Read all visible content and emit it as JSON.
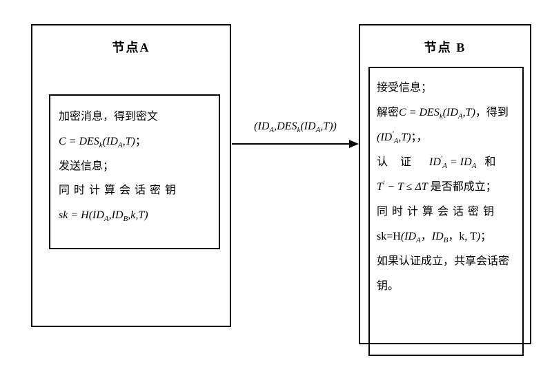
{
  "nodeA": {
    "title": "节点A",
    "lines": {
      "l1_prefix": "加密消息，得到密文",
      "l2_formula_C": "C",
      "l2_eq": " = ",
      "l2_des": "DES",
      "l2_k": "k",
      "l2_open": "(",
      "l2_ida": "ID",
      "l2_a": "A",
      "l2_comma": ",",
      "l2_t": "T",
      "l2_close": ")",
      "l2_semi": "；",
      "l3": "发送信息；",
      "l4": "同时计算会话密钥",
      "l5_sk": "sk",
      "l5_eq": " = ",
      "l5_h": "H",
      "l5_open": "(",
      "l5_ida": "ID",
      "l5_a": "A",
      "l5_c1": ",",
      "l5_idb": "ID",
      "l5_b": "B",
      "l5_c2": ",",
      "l5_k": "k",
      "l5_c3": ",",
      "l5_t": "T",
      "l5_close": ")"
    }
  },
  "arrow": {
    "label_open": "(",
    "label_ida": "ID",
    "label_a": "A",
    "label_c": ",",
    "label_des": "DES",
    "label_k": "k",
    "label_open2": "(",
    "label_ida2": "ID",
    "label_a2": "A",
    "label_c2": ",",
    "label_t": "T",
    "label_close2": ")",
    "label_close": ")"
  },
  "nodeB": {
    "title": "节点 B",
    "lines": {
      "l1": "接受信息；",
      "l2_prefix": "解密",
      "l2_c": "C",
      "l2_eq": " = ",
      "l2_des": "DES",
      "l2_k": "k",
      "l2_open": "(",
      "l2_ida": "ID",
      "l2_a": "A",
      "l2_comma": ",",
      "l2_t": "T",
      "l2_close": ")",
      "l2_suffix": "，得到",
      "l3_open": "(",
      "l3_id": "ID",
      "l3_prime": "'",
      "l3_a": "A",
      "l3_comma": ",",
      "l3_t": "T",
      "l3_close": ")",
      "l3_semi": "；，",
      "l4_prefix": "认证",
      "l4_id1": "ID",
      "l4_prime": "'",
      "l4_a1": "A",
      "l4_eq": " = ",
      "l4_id2": "ID",
      "l4_a2": "A",
      "l4_suffix": "和",
      "l5_t": "T",
      "l5_prime": "'",
      "l5_minus": " − ",
      "l5_t2": "T",
      "l5_le": " ≤ ",
      "l5_delta": "Δ",
      "l5_t3": "T",
      "l5_suffix": " 是否都成立；",
      "l6": "同时计算会话密钥",
      "l7_sk": "sk=H",
      "l7_open": "(",
      "l7_ida": "ID",
      "l7_a": "A",
      "l7_c1": "，",
      "l7_idb": "ID",
      "l7_b": "B",
      "l7_c2": "，",
      "l7_k": "k, T",
      "l7_close": ")",
      "l7_semi": "；",
      "l8": "如果认证成立，共享会话密",
      "l9": "钥。"
    }
  }
}
